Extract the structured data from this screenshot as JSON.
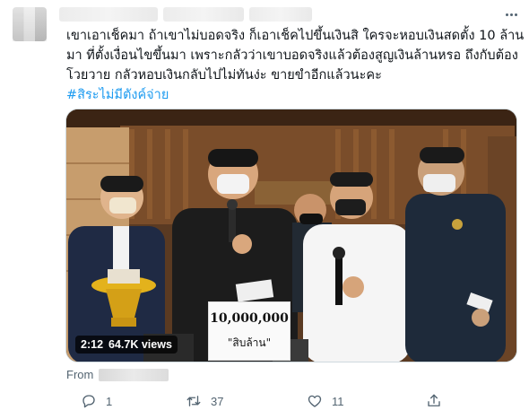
{
  "tweet": {
    "text_lines": [
      "เขาเอาเช็คมา ถ้าเขาไม่บอดจริง ก็เอาเช็คไปขึ้นเงินสิ ใครจะหอบเงินสดตั้ง 10 ล้าน",
      "มา ที่ตั้งเงื่อนไขขึ้นมา เพราะกลัวว่าเขาบอดจริงแล้วต้องสูญเงินล้านหรอ ถึงกับต้อง",
      "โวยวาย กลัวหอบเงินกลับไปไม่ทันง่ะ ขายขำอีกแล้วนะคะ"
    ],
    "hashtag": "#สิระไม่มีตังค์จ่าย",
    "video": {
      "duration": "2:12",
      "views": "64.7K views",
      "sign_amount": "10,000,000",
      "sign_text": "\"สิบล้าน\""
    },
    "from_label": "From"
  },
  "actions": {
    "reply_count": "1",
    "retweet_count": "37",
    "like_count": "11"
  },
  "icons": [
    "more-icon",
    "reply-icon",
    "retweet-icon",
    "like-icon",
    "share-icon"
  ],
  "colors": {
    "link": "#1d9bf0",
    "secondary_text": "#536471",
    "border": "#cfd9de"
  }
}
